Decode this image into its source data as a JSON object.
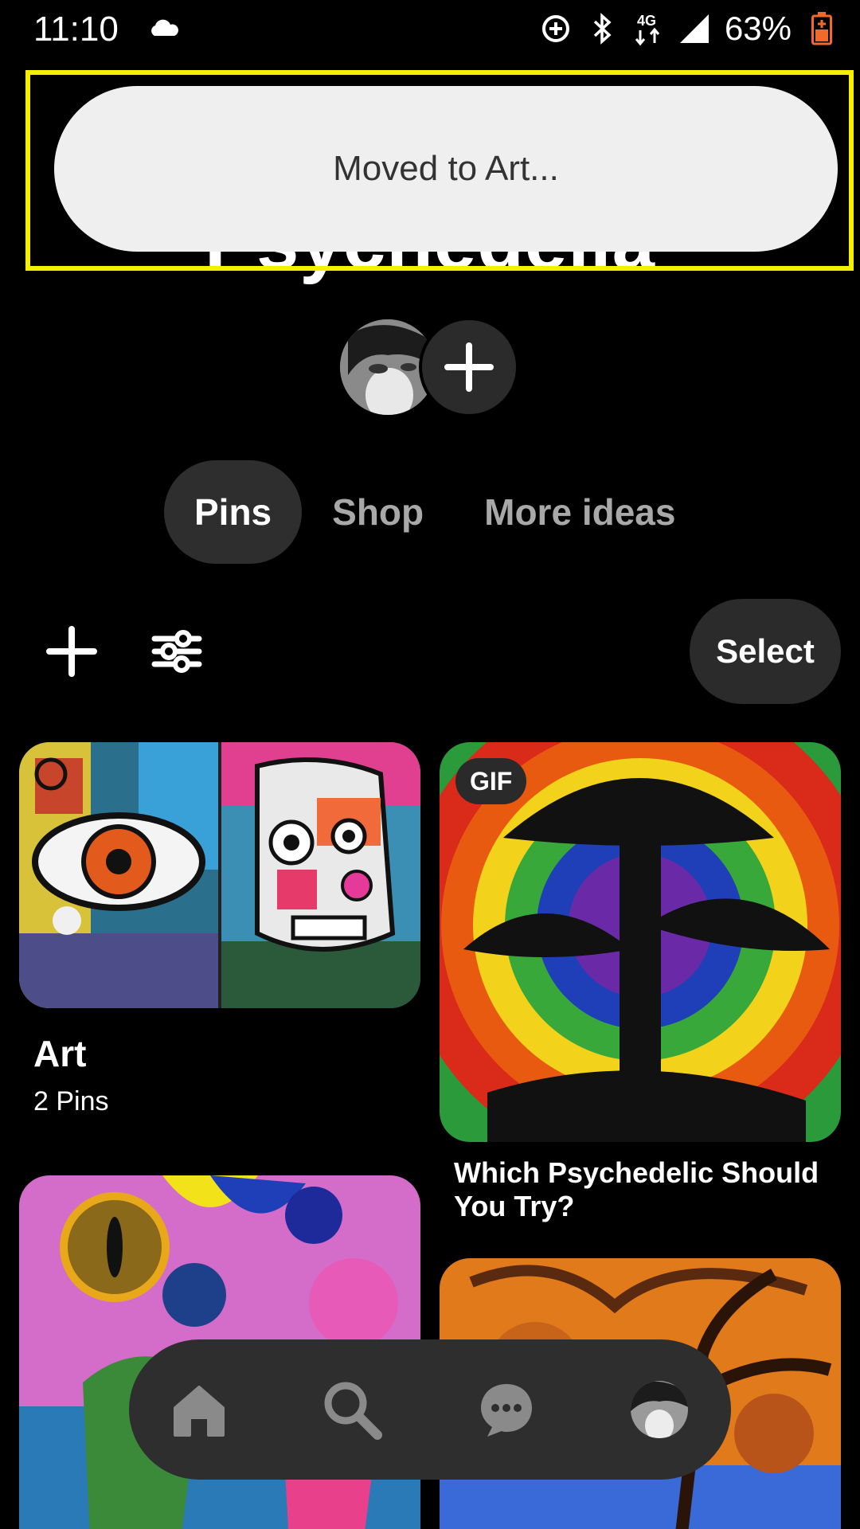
{
  "status_bar": {
    "time": "11:10",
    "battery": "63%",
    "icons": [
      "cloud-icon",
      "data-saver-icon",
      "bluetooth-icon",
      "4g-icon",
      "signal-icon",
      "battery-icon"
    ]
  },
  "board": {
    "title": "Psychedelia"
  },
  "toast": {
    "message": "Moved to Art..."
  },
  "tabs": [
    {
      "label": "Pins",
      "active": true
    },
    {
      "label": "Shop",
      "active": false
    },
    {
      "label": "More ideas",
      "active": false
    }
  ],
  "toolbar": {
    "select_label": "Select",
    "icons": [
      "plus-icon",
      "filter-icon"
    ]
  },
  "grid": {
    "section_card": {
      "title": "Art",
      "subtitle": "2 Pins"
    },
    "pin_1": {
      "badge": "GIF",
      "title": "Which Psychedelic Should You Try?"
    }
  },
  "bottom_nav": {
    "items": [
      "home-icon",
      "search-icon",
      "messages-icon",
      "profile-avatar"
    ]
  },
  "colors": {
    "background": "#000000",
    "toast_bg": "#efefef",
    "highlight": "#f7ef00",
    "pill_bg": "#2e2e2e"
  }
}
